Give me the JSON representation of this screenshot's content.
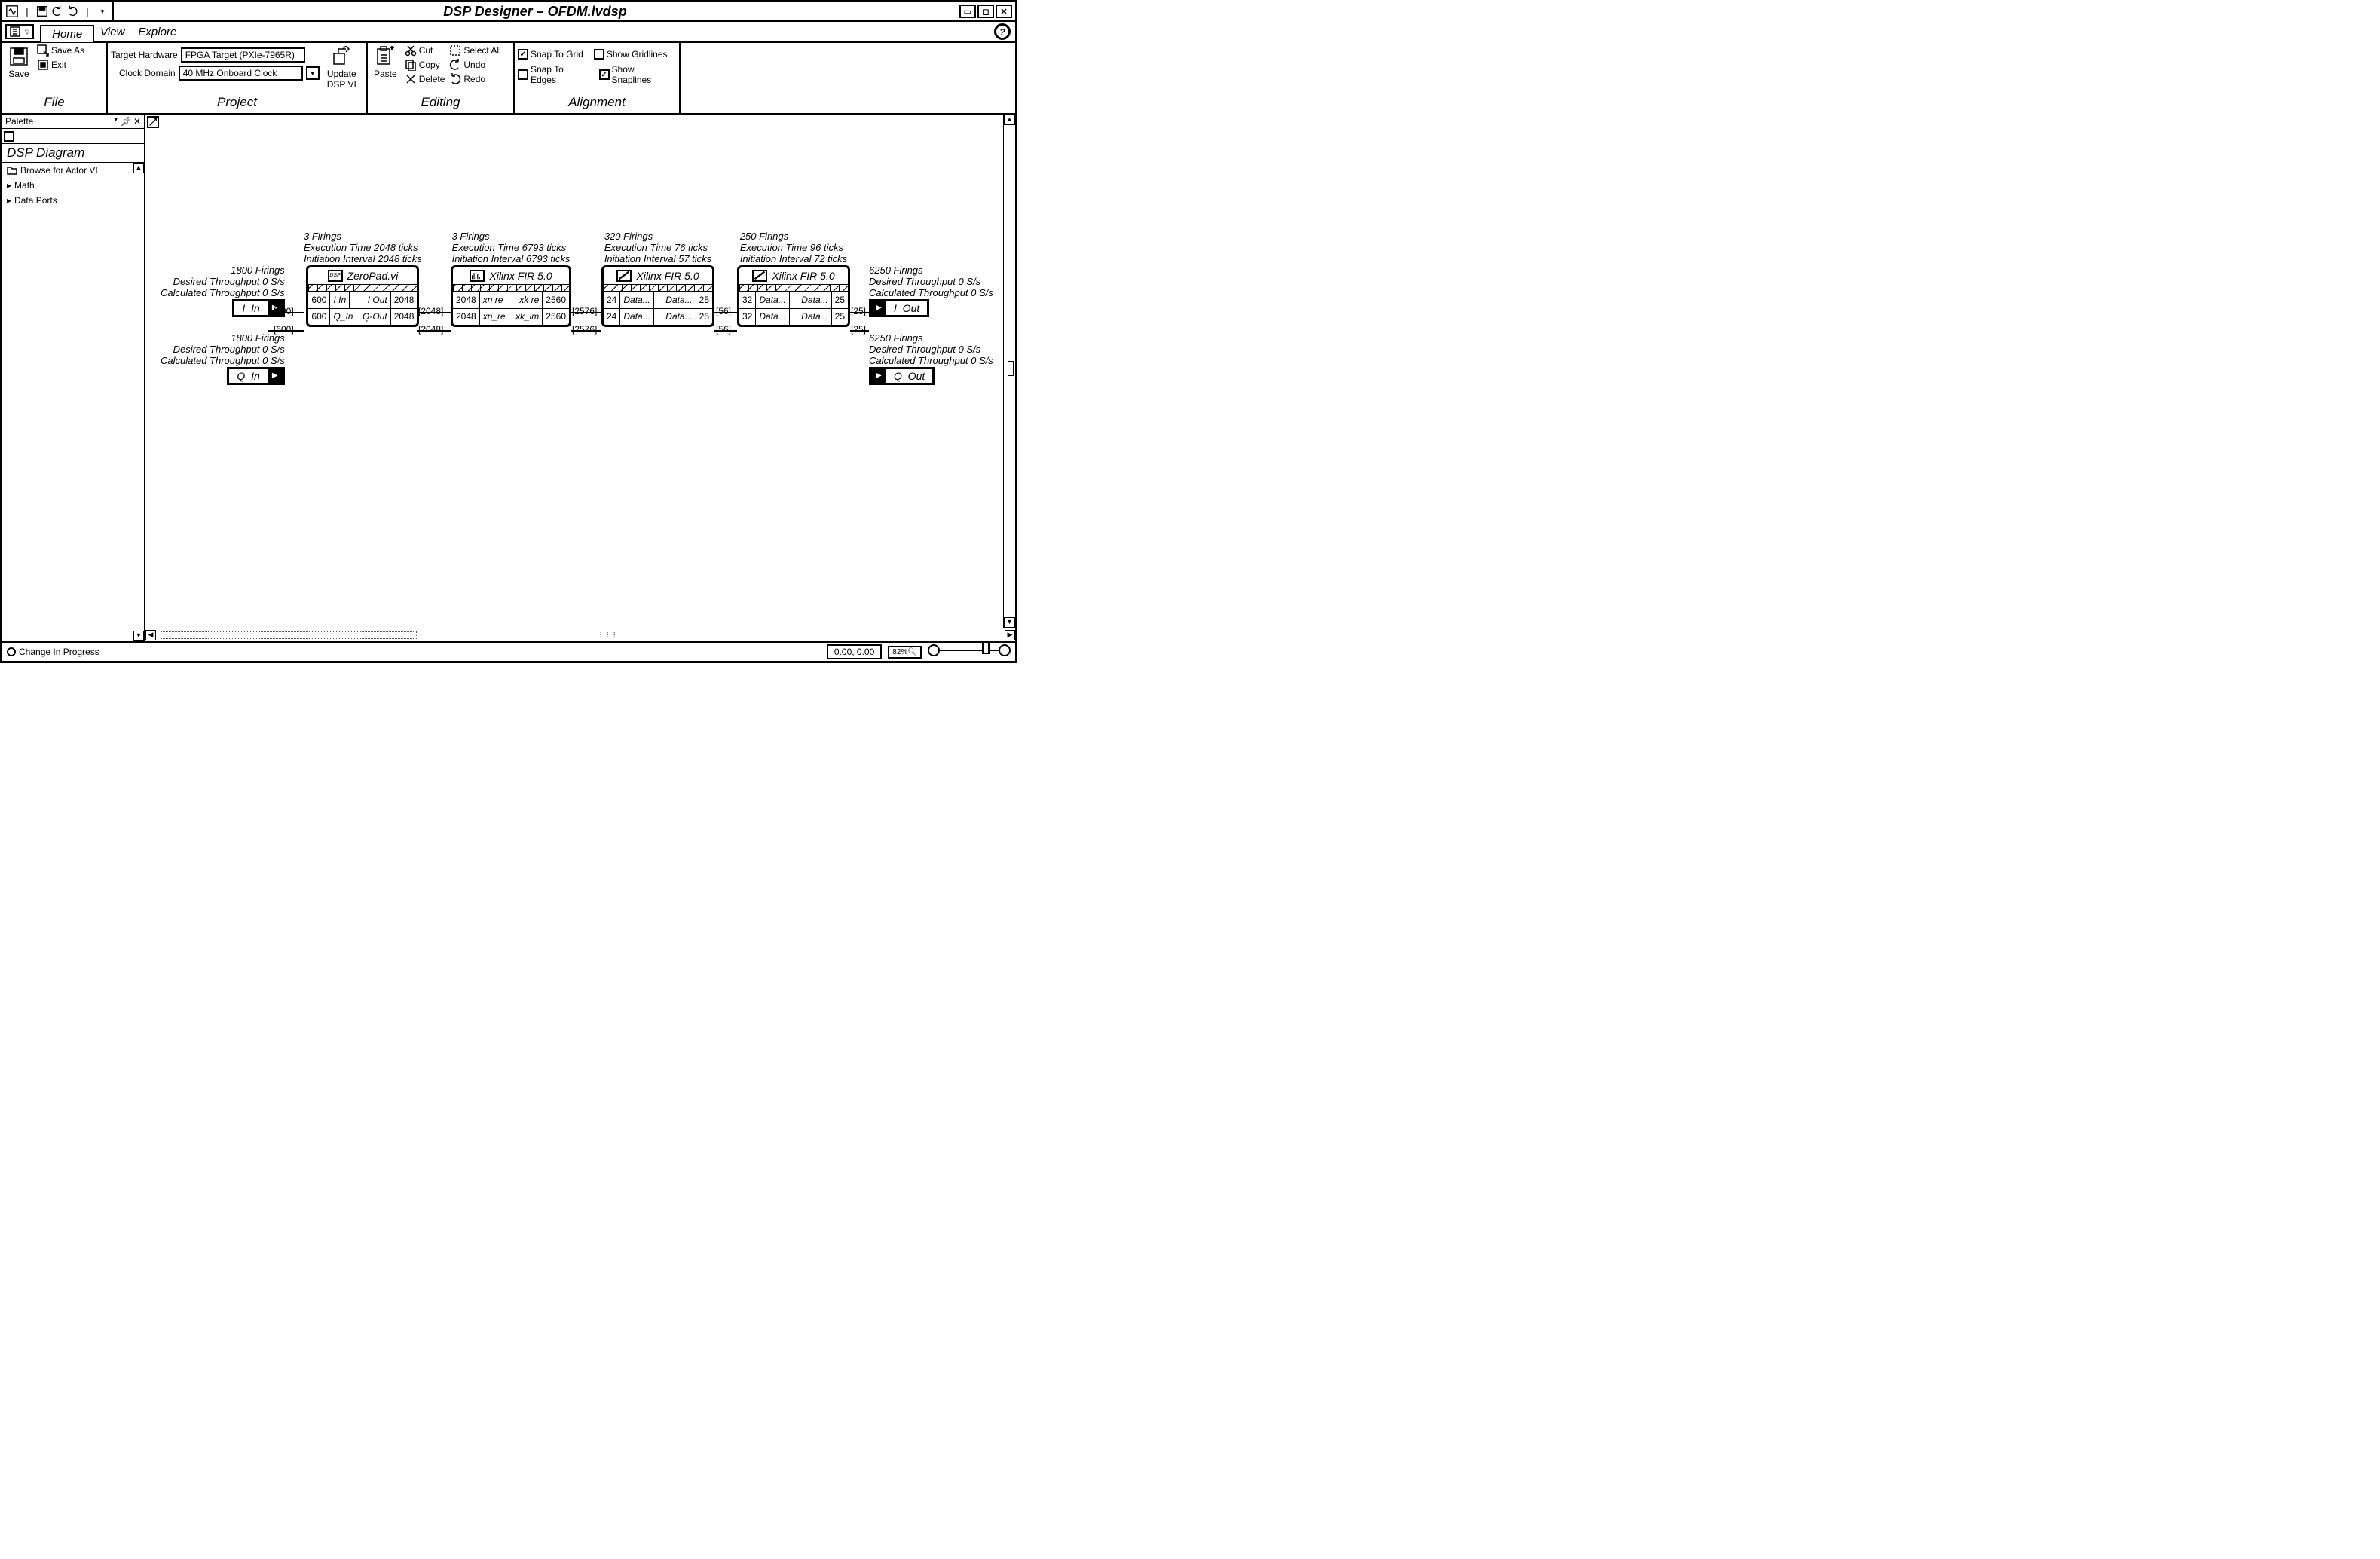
{
  "title": "DSP Designer – OFDM.lvdsp",
  "menubar": {
    "home": "Home",
    "view": "View",
    "explore": "Explore"
  },
  "ribbon": {
    "file": {
      "label": "File",
      "save": "Save",
      "save_as": "Save As",
      "exit": "Exit"
    },
    "project": {
      "label": "Project",
      "target_hw_label": "Target Hardware",
      "target_hw_value": "FPGA Target (PXIe-7965R)",
      "clock_label": "Clock Domain",
      "clock_value": "40 MHz Onboard Clock",
      "update": "Update\nDSP VI"
    },
    "editing": {
      "label": "Editing",
      "paste": "Paste",
      "cut": "Cut",
      "copy": "Copy",
      "delete": "Delete",
      "select_all": "Select All",
      "undo": "Undo",
      "redo": "Redo"
    },
    "alignment": {
      "label": "Alignment",
      "snap_grid": "Snap To Grid",
      "show_gridlines": "Show Gridlines",
      "snap_edges": "Snap To Edges",
      "show_snaplines": "Show Snaplines"
    }
  },
  "palette": {
    "title": "Palette",
    "section": "DSP Diagram",
    "browse": "Browse for Actor VI",
    "math": "Math",
    "data_ports": "Data Ports"
  },
  "io": {
    "i_in": {
      "label": "I_In",
      "firings": "1800 Firings",
      "desired": "Desired Throughput 0 S/s",
      "calculated": "Calculated Throughput 0 S/s"
    },
    "q_in": {
      "label": "Q_In",
      "firings": "1800 Firings",
      "desired": "Desired Throughput 0 S/s",
      "calculated": "Calculated Throughput 0 S/s"
    },
    "i_out": {
      "label": "I_Out",
      "firings": "6250 Firings",
      "desired": "Desired Throughput 0 S/s",
      "calculated": "Calculated Throughput 0 S/s"
    },
    "q_out": {
      "label": "Q_Out",
      "firings": "6250 Firings",
      "desired": "Desired Throughput 0 S/s",
      "calculated": "Calculated Throughput 0 S/s"
    }
  },
  "nodes": {
    "n1": {
      "title": "ZeroPad.vi",
      "info1": "3 Firings",
      "info2": "Execution Time 2048 ticks",
      "info3": "Initiation Interval 2048 ticks",
      "r1": {
        "a": "600",
        "b": "I In",
        "c": "I Out",
        "d": "2048"
      },
      "r2": {
        "a": "600",
        "b": "Q_In",
        "c": "Q-Out",
        "d": "2048"
      }
    },
    "n2": {
      "title": "Xilinx FIR 5.0",
      "info1": "3 Firings",
      "info2": "Execution Time 6793 ticks",
      "info3": "Initiation Interval 6793 ticks",
      "r1": {
        "a": "2048",
        "b": "xn re",
        "c": "xk re",
        "d": "2560"
      },
      "r2": {
        "a": "2048",
        "b": "xn_re",
        "c": "xk_im",
        "d": "2560"
      }
    },
    "n3": {
      "title": "Xilinx FIR 5.0",
      "info1": "320 Firings",
      "info2": "Execution Time 76 ticks",
      "info3": "Initiation Interval 57 ticks",
      "r1": {
        "a": "24",
        "b": "Data...",
        "c": "Data...",
        "d": "25"
      },
      "r2": {
        "a": "24",
        "b": "Data...",
        "c": "Data...",
        "d": "25"
      }
    },
    "n4": {
      "title": "Xilinx FIR 5.0",
      "info1": "250 Firings",
      "info2": "Execution Time 96 ticks",
      "info3": "Initiation Interval 72 ticks",
      "r1": {
        "a": "32",
        "b": "Data...",
        "c": "Data...",
        "d": "25"
      },
      "r2": {
        "a": "32",
        "b": "Data...",
        "c": "Data...",
        "d": "25"
      }
    }
  },
  "wires": {
    "w_in_top": "[600]",
    "w_in_bot": "[600]",
    "w_12_top": "[2048]",
    "w_12_bot": "[2048]",
    "w_23_top": "[2576]",
    "w_23_bot": "[2576]",
    "w_34_top": "[56]",
    "w_34_bot": "[56]",
    "w_out_top": "[25]",
    "w_out_bot": "[25]"
  },
  "status": {
    "change": "Change In Progress",
    "coords": "0.00, 0.00",
    "zoom": "82%"
  }
}
